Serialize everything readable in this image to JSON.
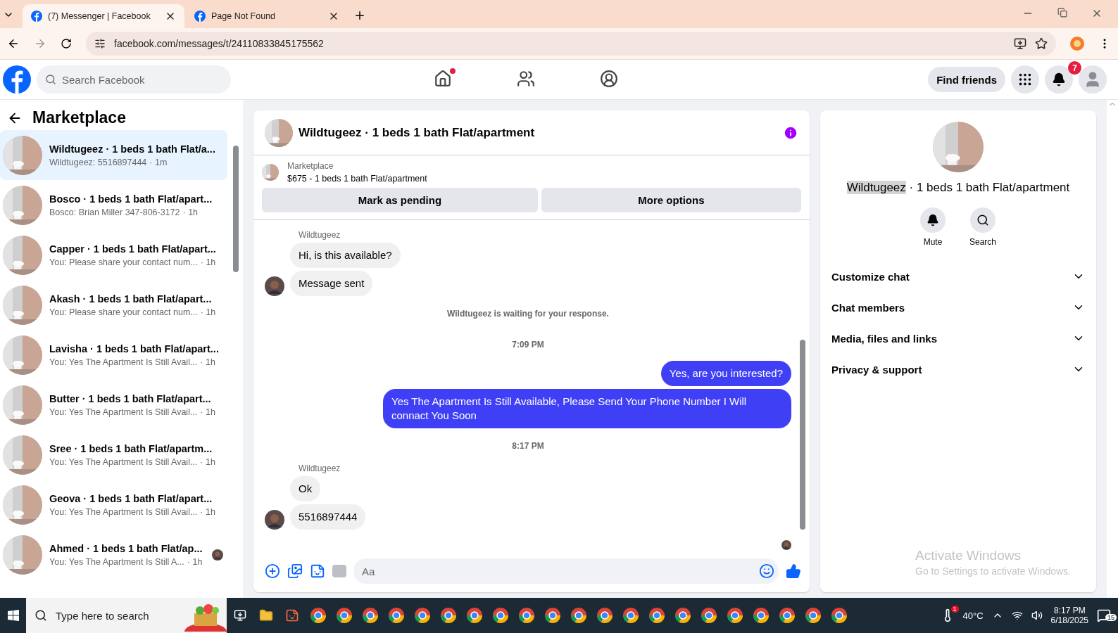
{
  "browser": {
    "tabs": [
      {
        "title": "(7) Messenger | Facebook",
        "selected": true
      },
      {
        "title": "Page Not Found",
        "selected": false
      }
    ],
    "url": "facebook.com/messages/t/24110833845175562"
  },
  "header": {
    "search_placeholder": "Search Facebook",
    "find_friends": "Find friends",
    "notification_count": "7",
    "home_unread": true
  },
  "sidebar": {
    "title": "Marketplace",
    "conversations": [
      {
        "title": "Wildtugeez · 1 beds 1 bath Flat/a...",
        "preview": "Wildtugeez: 5516897444",
        "time": "· 1m",
        "selected": true,
        "seen": false
      },
      {
        "title": "Bosco · 1 beds 1 bath Flat/apart...",
        "preview": "Bosco: Brian Miller 347-806-3172",
        "time": "· 1h",
        "selected": false,
        "seen": false
      },
      {
        "title": "Capper · 1 beds 1 bath Flat/apart...",
        "preview": "You: Please share your contact num...",
        "time": "· 1h",
        "selected": false,
        "seen": false
      },
      {
        "title": "Akash · 1 beds 1 bath Flat/apart...",
        "preview": "You: Please share your contact num...",
        "time": "· 1h",
        "selected": false,
        "seen": false
      },
      {
        "title": "Lavisha · 1 beds 1 bath Flat/apart...",
        "preview": "You: Yes The Apartment Is Still Avail...",
        "time": "· 1h",
        "selected": false,
        "seen": false
      },
      {
        "title": "Butter · 1 beds 1 bath Flat/apart...",
        "preview": "You: Yes The Apartment Is Still Avail...",
        "time": "· 1h",
        "selected": false,
        "seen": false
      },
      {
        "title": "Sree · 1 beds 1 bath Flat/apartm...",
        "preview": "You: Yes The Apartment Is Still Avail...",
        "time": "· 1h",
        "selected": false,
        "seen": false
      },
      {
        "title": "Geova · 1 beds 1 bath Flat/apart...",
        "preview": "You: Yes The Apartment Is Still Avail...",
        "time": "· 1h",
        "selected": false,
        "seen": false
      },
      {
        "title": "Ahmed · 1 beds 1 bath Flat/ap...",
        "preview": "You: Yes The Apartment Is Still A...",
        "time": "· 1h",
        "selected": false,
        "seen": true
      }
    ]
  },
  "chat": {
    "title": "Wildtugeez · 1 beds 1 bath Flat/apartment",
    "listing": {
      "label": "Marketplace",
      "text": "$675 - 1 beds 1 bath Flat/apartment"
    },
    "actions": [
      "Mark as pending",
      "More options"
    ],
    "messages": [
      {
        "kind": "sender",
        "text": "Wildtugeez"
      },
      {
        "kind": "incoming",
        "text": "Hi, is this available?",
        "avatar": false
      },
      {
        "kind": "incoming",
        "text": "Message sent",
        "avatar": true
      },
      {
        "kind": "notice",
        "text": "Wildtugeez is waiting for your response."
      },
      {
        "kind": "time",
        "text": "7:09 PM"
      },
      {
        "kind": "outgoing",
        "text": "Yes, are you interested?"
      },
      {
        "kind": "outgoing",
        "text": "Yes The Apartment Is Still Available, Please Send Your Phone Number I Will connact You Soon"
      },
      {
        "kind": "time",
        "text": "8:17 PM"
      },
      {
        "kind": "sender",
        "text": "Wildtugeez"
      },
      {
        "kind": "incoming",
        "text": "Ok",
        "avatar": false
      },
      {
        "kind": "incoming",
        "text": "5516897444",
        "avatar": true
      },
      {
        "kind": "seen"
      }
    ],
    "composer_placeholder": "Aa"
  },
  "details": {
    "name": "Wildtugeez",
    "name_highlighted": true,
    "rest": " · 1 beds 1 bath Flat/apartment",
    "actions": [
      {
        "kind": "mute",
        "label": "Mute"
      },
      {
        "kind": "search",
        "label": "Search"
      }
    ],
    "sections": [
      "Customize chat",
      "Chat members",
      "Media, files and links",
      "Privacy & support"
    ]
  },
  "activation": {
    "title": "Activate Windows",
    "text": "Go to Settings to activate Windows."
  },
  "taskbar": {
    "search_placeholder": "Type here to search",
    "weather_badge": "1",
    "temperature": "40°C",
    "time": "8:17 PM",
    "date": "6/18/2025",
    "notifications": "15"
  }
}
